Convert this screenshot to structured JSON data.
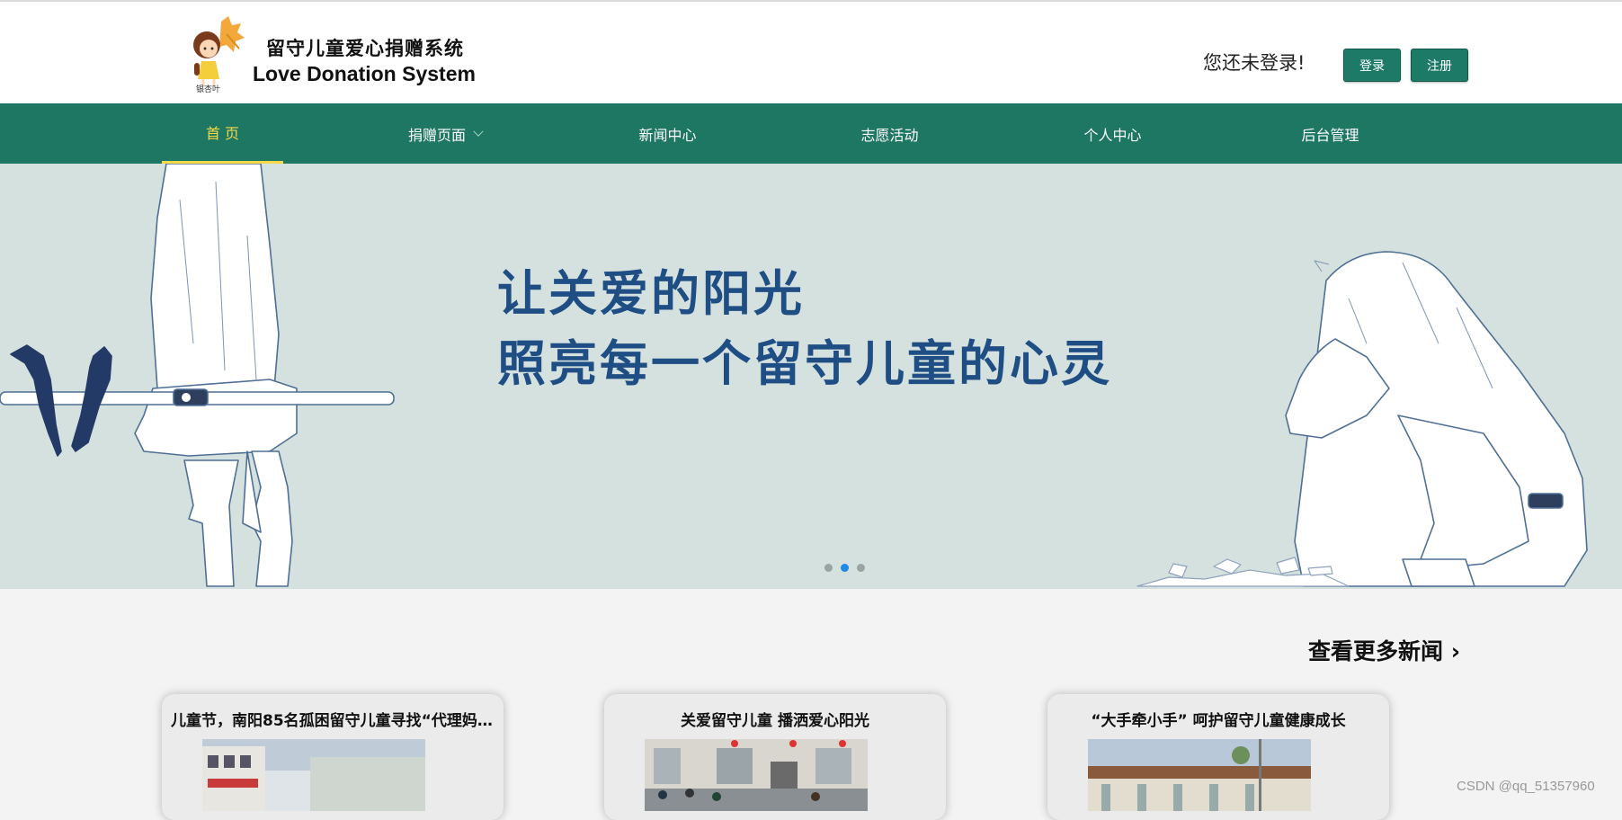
{
  "header": {
    "logo_mini_text": "银杏叶",
    "title_zh": "留守儿童爱心捐赠系统",
    "title_en": "Love Donation System",
    "login_status": "您还未登录!",
    "login_label": "登录",
    "register_label": "注册"
  },
  "nav": {
    "items": [
      {
        "label": "首 页",
        "active": true
      },
      {
        "label": "捐赠页面",
        "has_dropdown": true
      },
      {
        "label": "新闻中心"
      },
      {
        "label": "志愿活动"
      },
      {
        "label": "个人中心"
      },
      {
        "label": "后台管理"
      }
    ]
  },
  "banner": {
    "line1": "让关爱的阳光",
    "line2": "照亮每一个留守儿童的心灵",
    "slide_count": 3,
    "active_slide": 2
  },
  "news": {
    "more_label": "查看更多新闻 ›",
    "cards": [
      {
        "title": "儿童节，南阳85名孤困留守儿童寻找“代理妈..."
      },
      {
        "title": "关爱留守儿童 播洒爱心阳光"
      },
      {
        "title": "“大手牵小手” 呵护留守儿童健康成长"
      }
    ]
  },
  "watermark": "CSDN @qq_51357960",
  "colors": {
    "nav_bg": "#1e7762",
    "nav_active": "#f5d949",
    "button_bg": "#1d7a66",
    "banner_bg": "#d4e1de",
    "slogan": "#1f4e85",
    "dot_active": "#1e88e5"
  }
}
